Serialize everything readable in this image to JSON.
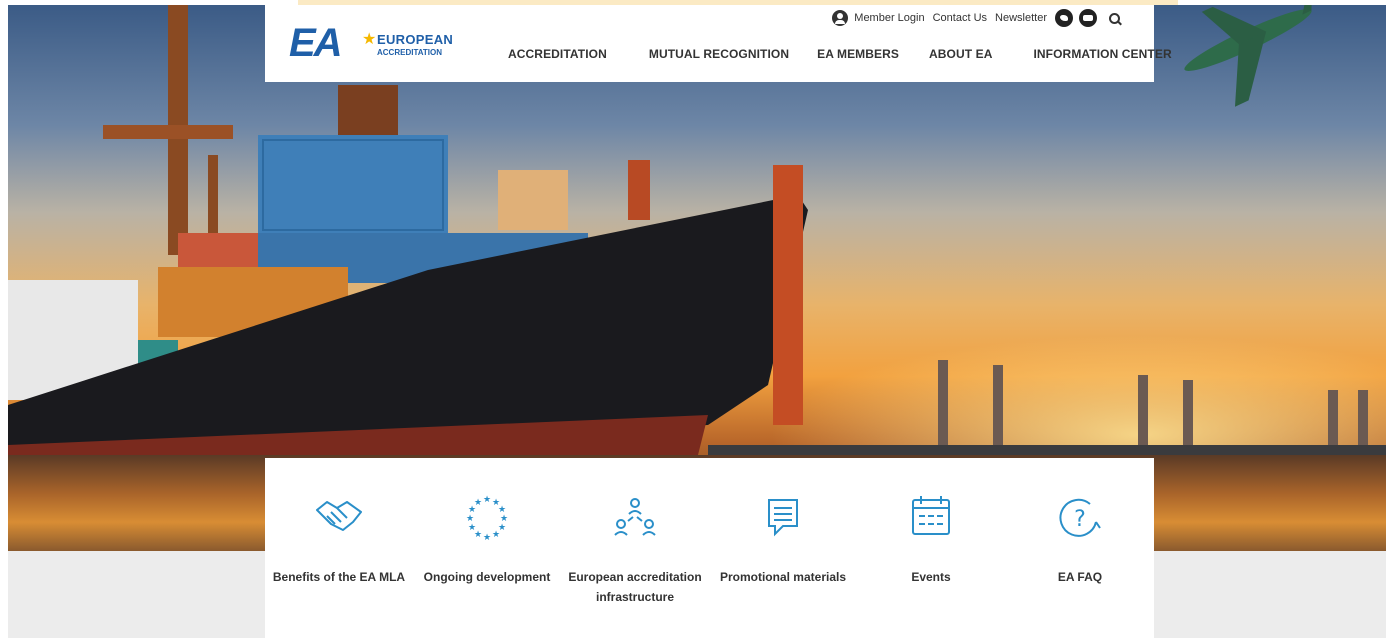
{
  "brand": {
    "logo_mark": "EA",
    "logo_line1": "EUROPEAN",
    "logo_line2": "ACCREDITATION"
  },
  "utility_nav": {
    "member_login": "Member Login",
    "contact_us": "Contact Us",
    "newsletter": "Newsletter",
    "icons": [
      "user-icon",
      "twitter-icon",
      "youtube-icon",
      "search-icon"
    ]
  },
  "main_nav": {
    "items": [
      {
        "label": "ACCREDITATION"
      },
      {
        "label": "MUTUAL RECOGNITION"
      },
      {
        "label": "EA MEMBERS"
      },
      {
        "label": "ABOUT EA"
      },
      {
        "label": "INFORMATION CENTER"
      }
    ]
  },
  "features": {
    "items": [
      {
        "label": "Benefits of the EA MLA",
        "icon": "handshake-icon"
      },
      {
        "label": "Ongoing development",
        "icon": "eu-stars-icon"
      },
      {
        "label": "European accreditation infrastructure",
        "icon": "network-people-icon"
      },
      {
        "label": "Promotional materials",
        "icon": "document-icon"
      },
      {
        "label": "Events",
        "icon": "calendar-icon"
      },
      {
        "label": "EA FAQ",
        "icon": "question-icon"
      }
    ]
  },
  "colors": {
    "brand_blue": "#1f5fa8",
    "icon_blue": "#2a8fc9",
    "star_gold": "#f5b800"
  }
}
